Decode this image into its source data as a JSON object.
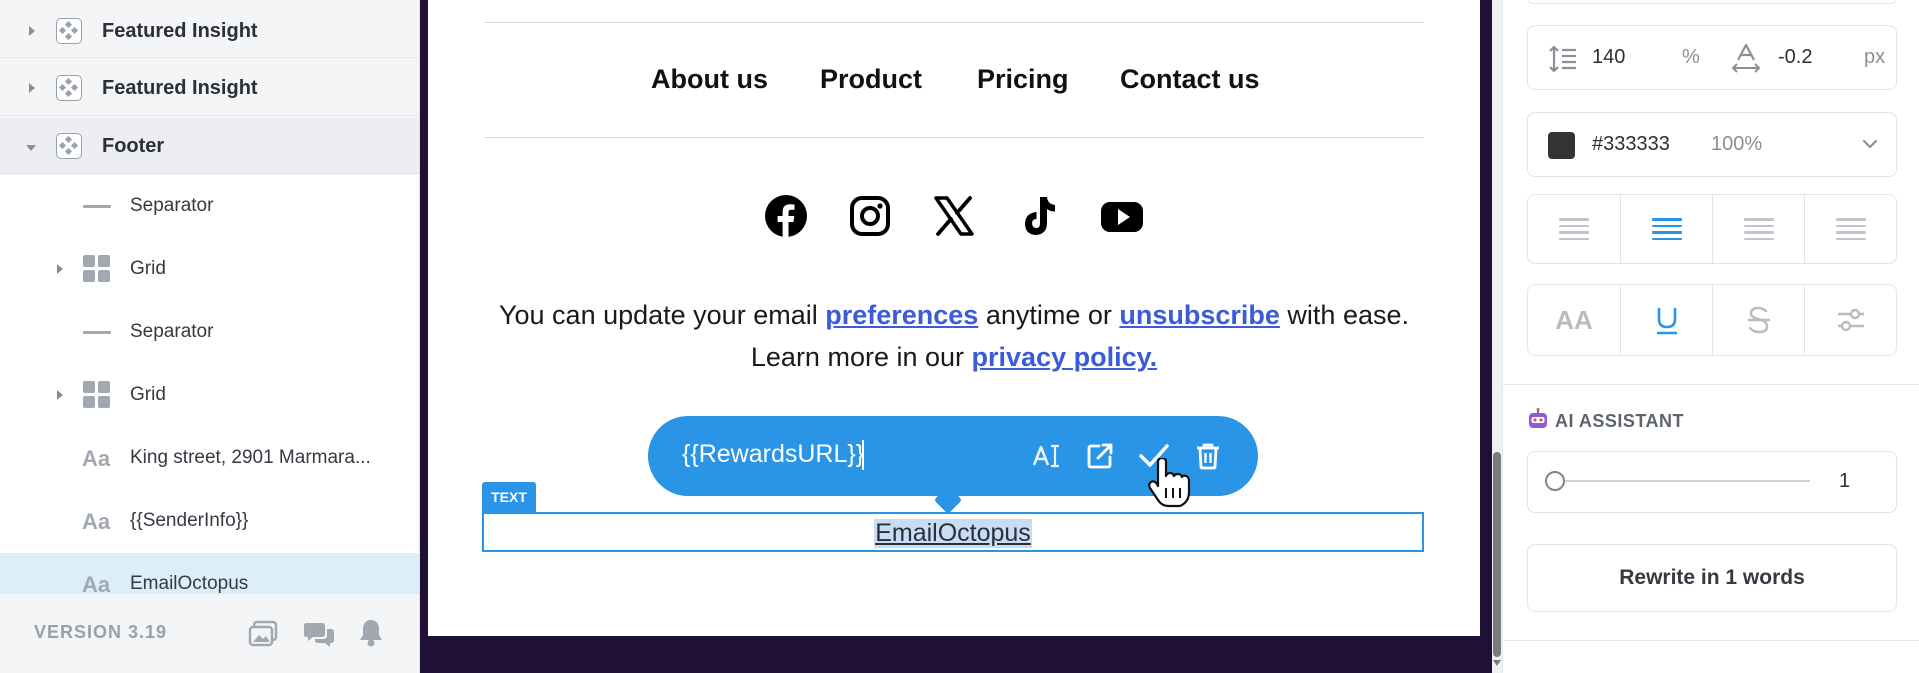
{
  "layers": {
    "items": [
      {
        "label": "Featured Insight",
        "kind": "component",
        "expanded": false
      },
      {
        "label": "Featured Insight",
        "kind": "component",
        "expanded": false
      },
      {
        "label": "Footer",
        "kind": "component",
        "expanded": true
      },
      {
        "label": "Separator",
        "kind": "separator"
      },
      {
        "label": "Grid",
        "kind": "grid",
        "expanded": false
      },
      {
        "label": "Separator",
        "kind": "separator"
      },
      {
        "label": "Grid",
        "kind": "grid",
        "expanded": false
      },
      {
        "label": "King street, 2901 Marmara...",
        "kind": "text"
      },
      {
        "label": "{{SenderInfo}}",
        "kind": "text"
      },
      {
        "label": "EmailOctopus",
        "kind": "text",
        "selected": true
      }
    ],
    "version": "VERSION 3.19"
  },
  "email": {
    "nav": [
      "About us",
      "Product",
      "Pricing",
      "Contact us"
    ],
    "social_icons": [
      "facebook-icon",
      "instagram-icon",
      "x-icon",
      "tiktok-icon",
      "youtube-icon"
    ],
    "legal": {
      "part1": "You can update your email ",
      "link1": "preferences",
      "part2": " anytime or ",
      "link2": "unsubscribe",
      "part3": " with ease.",
      "part4": "Learn more in our ",
      "link3": "privacy policy."
    },
    "link_toolbar": {
      "url": "{{RewardsURL}}",
      "icons": [
        "text-format-icon",
        "open-external-icon",
        "confirm-icon",
        "trash-icon"
      ]
    },
    "selected_block": {
      "tag": "TEXT",
      "text": "EmailOctopus"
    }
  },
  "properties": {
    "line_height": {
      "value": "140",
      "unit": "%"
    },
    "letter_spacing": {
      "value": "-0.2",
      "unit": "px"
    },
    "color": {
      "hex": "#333333",
      "opacity": "100%"
    },
    "text_align": {
      "options": [
        "left",
        "center",
        "right",
        "justify"
      ],
      "selected": "center"
    },
    "text_decoration": {
      "options": [
        "uppercase",
        "underline",
        "strikethrough",
        "settings"
      ],
      "selected": "underline"
    },
    "ai_assistant": {
      "title": "AI ASSISTANT",
      "slider_value": "1",
      "button_label": "Rewrite in 1 words"
    }
  },
  "colors": {
    "accent": "#2a95e6",
    "canvas_bg": "#1f1136",
    "link": "#3b5bd9",
    "text_color": "#333333"
  }
}
